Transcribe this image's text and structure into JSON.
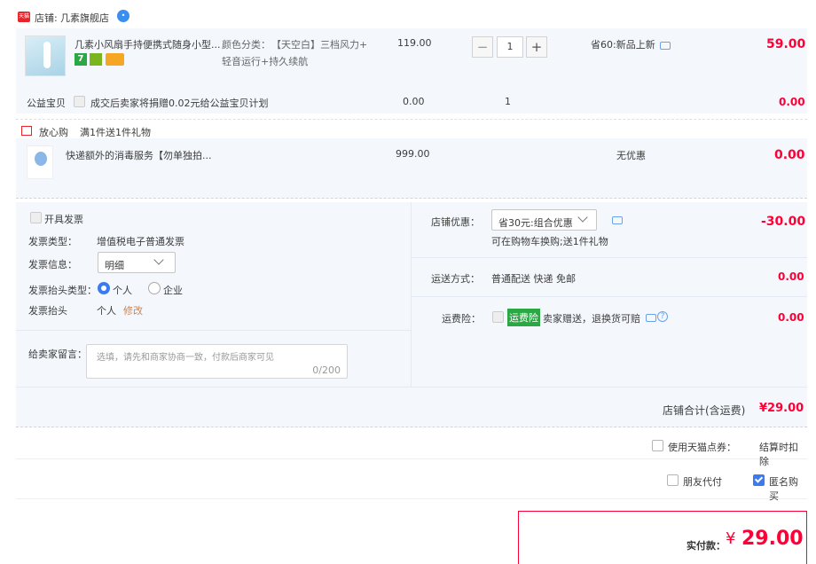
{
  "shop": {
    "badge": "天猫",
    "label": "店铺:",
    "name": "几素旗舰店",
    "service_icon": "chat-bubble-icon"
  },
  "item1": {
    "title": "几素小风扇手持便携式随身小型...",
    "spec_label": "颜色分类：",
    "spec_value": "【天空白】三档风力+",
    "spec_value2": "轻音运行+持久续航",
    "price": "119.00",
    "qty": "1",
    "discount": "省60:新品上新",
    "total": "59.00",
    "minus": "−",
    "plus": "+"
  },
  "charity": {
    "label": "公益宝贝",
    "text": "成交后卖家将捐赠0.02元给公益宝贝计划",
    "price": "0.00",
    "qty": "1",
    "total": "0.00"
  },
  "gift": {
    "label": "放心购",
    "text": "满1件送1件礼物"
  },
  "item2": {
    "title": "快递额外的消毒服务【勿单独拍...",
    "price": "999.00",
    "discount": "无优惠",
    "total": "0.00"
  },
  "invoice": {
    "open_label": "开具发票",
    "type_label": "发票类型：",
    "type_value": "增值税电子普通发票",
    "info_label": "发票信息：",
    "info_value": "明细",
    "header_type_label": "发票抬头类型：",
    "opt_personal": "个人",
    "opt_company": "企业",
    "header_label": "发票抬头",
    "header_value": "个人",
    "edit": "修改"
  },
  "message": {
    "label": "给卖家留言：",
    "placeholder": "选填，请先和商家协商一致，付款后商家可见",
    "counter": "0/200"
  },
  "promo": {
    "label": "店铺优惠：",
    "value": "省30元:组合优惠",
    "note": "可在购物车换购;送1件礼物",
    "amount": "-30.00"
  },
  "shipping": {
    "label": "运送方式：",
    "value": "普通配送 快递 免邮",
    "amount": "0.00"
  },
  "insurance": {
    "label": "运费险：",
    "badge": "运费险",
    "text": "卖家赠送，退换货可赔",
    "amount": "0.00"
  },
  "subtotal": {
    "label": "店铺合计(含运费)",
    "value": "¥29.00"
  },
  "points": {
    "label": "使用天猫点券：",
    "note": "结算时扣除"
  },
  "options": {
    "friend_pay": "朋友代付",
    "anonymous": "匿名购买"
  },
  "payment": {
    "label": "实付款：",
    "currency": "¥",
    "amount": "29.00"
  },
  "colors": {
    "accent": "#ff0036",
    "blue": "#3a7cf0",
    "panel": "#f4f8fd"
  }
}
